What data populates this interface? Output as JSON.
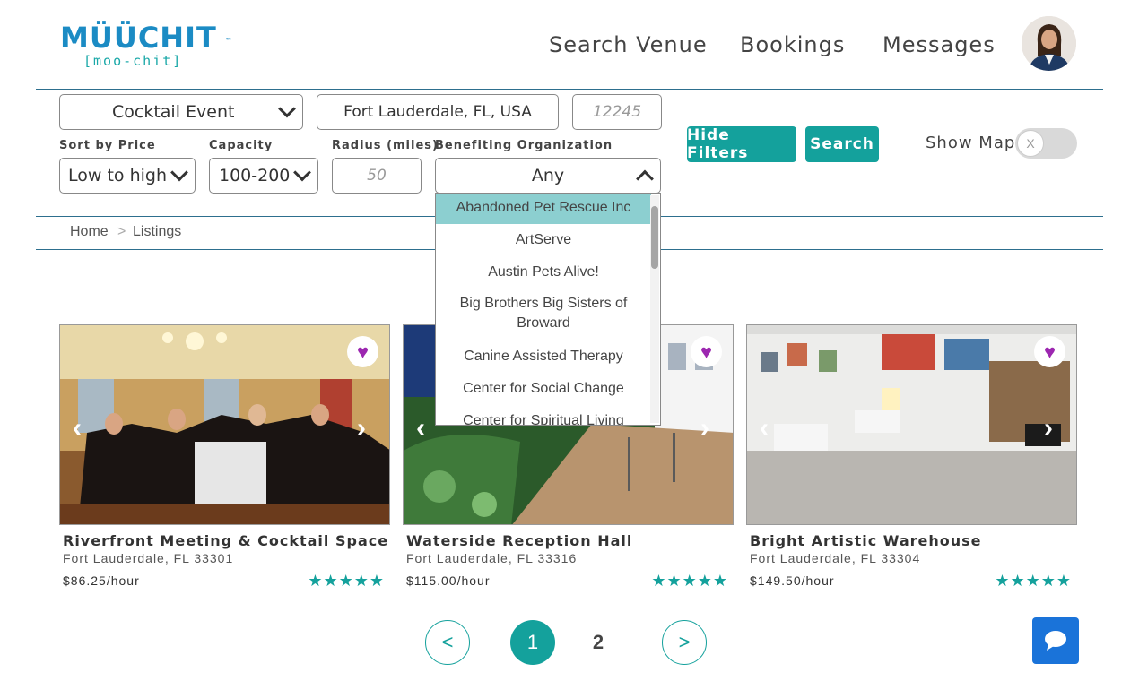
{
  "brand": {
    "name": "MÜÜCHIT",
    "tm": "™",
    "tagline": "[moo-chit]"
  },
  "nav": {
    "search_venue": "Search Venue",
    "bookings": "Bookings",
    "messages": "Messages"
  },
  "filters": {
    "event_type": "Cocktail Event",
    "location": "Fort Lauderdale, FL, USA",
    "zip_placeholder": "12245",
    "sort_label": "Sort by Price",
    "sort_value": "Low to high",
    "capacity_label": "Capacity",
    "capacity_value": "100-200",
    "radius_label": "Radius (miles)",
    "radius_placeholder": "50",
    "org_label": "Benefiting Organization",
    "org_value": "Any",
    "hide_filters": "Hide Filters",
    "search": "Search",
    "show_map": "Show Map",
    "toggle_mark": "X"
  },
  "dropdown_items": [
    "Abandoned Pet Rescue Inc",
    "ArtServe",
    "Austin Pets Alive!",
    "Big Brothers Big Sisters of Broward",
    "Canine Assisted Therapy",
    "Center for Social Change",
    "Center for Spiritual Living"
  ],
  "breadcrumb": {
    "home": "Home",
    "separator": ">",
    "current": "Listings"
  },
  "listings": [
    {
      "title": "Riverfront Meeting & Cocktail Space",
      "location": "Fort Lauderdale, FL 33301",
      "price": "$86.25/hour",
      "stars": "★★★★★",
      "rating": 5
    },
    {
      "title": "Waterside Reception Hall",
      "location": "Fort Lauderdale, FL 33316",
      "price": "$115.00/hour",
      "stars": "★★★★★",
      "rating": 5
    },
    {
      "title": "Bright Artistic Warehouse",
      "location": "Fort Lauderdale, FL 33304",
      "price": "$149.50/hour",
      "stars": "★★★★★",
      "rating": 5
    }
  ],
  "pagination": {
    "prev": "<",
    "page1": "1",
    "page2": "2",
    "next": ">"
  },
  "colors": {
    "brand_blue": "#1b8bc4",
    "teal": "#14a19c",
    "heart_purple": "#9c27b0",
    "chat_blue": "#1a73d9"
  }
}
